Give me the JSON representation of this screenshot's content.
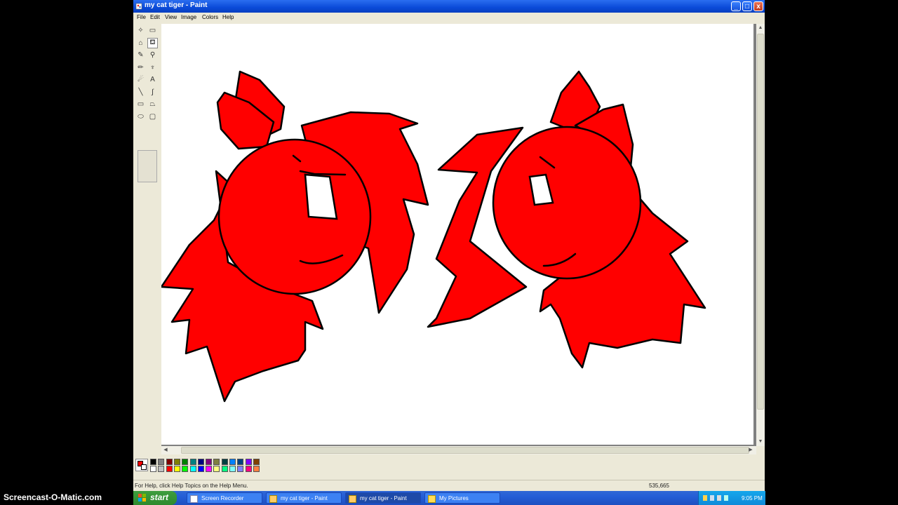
{
  "window": {
    "title": "my cat tiger - Paint",
    "controls": {
      "minimize": "_",
      "maximize": "□",
      "close": "x"
    }
  },
  "menu": {
    "items": [
      "File",
      "Edit",
      "View",
      "Image",
      "Colors",
      "Help"
    ]
  },
  "tools": [
    {
      "name": "free-form-select-icon",
      "glyph": "✧"
    },
    {
      "name": "rect-select-icon",
      "glyph": "▭"
    },
    {
      "name": "eraser-icon",
      "glyph": "⌂"
    },
    {
      "name": "fill-bucket-icon",
      "glyph": "⛾"
    },
    {
      "name": "color-picker-icon",
      "glyph": "✎"
    },
    {
      "name": "magnifier-icon",
      "glyph": "⚲"
    },
    {
      "name": "pencil-icon",
      "glyph": "✏"
    },
    {
      "name": "brush-icon",
      "glyph": "♆"
    },
    {
      "name": "airbrush-icon",
      "glyph": "☄"
    },
    {
      "name": "text-icon",
      "glyph": "A"
    },
    {
      "name": "line-icon",
      "glyph": "╲"
    },
    {
      "name": "curve-icon",
      "glyph": "∫"
    },
    {
      "name": "rectangle-icon",
      "glyph": "▭"
    },
    {
      "name": "polygon-icon",
      "glyph": "⏢"
    },
    {
      "name": "ellipse-icon",
      "glyph": "⬭"
    },
    {
      "name": "rounded-rectangle-icon",
      "glyph": "▢"
    }
  ],
  "selected_tool": "fill-bucket-icon",
  "palette": {
    "foreground": "#ff0000",
    "background": "#ffffff",
    "row1": [
      "#000000",
      "#808080",
      "#800000",
      "#808000",
      "#008000",
      "#008080",
      "#000080",
      "#800080",
      "#808040",
      "#004040",
      "#0080ff",
      "#004080",
      "#8000ff",
      "#804000"
    ],
    "row2": [
      "#ffffff",
      "#c0c0c0",
      "#ff0000",
      "#ffff00",
      "#00ff00",
      "#00ffff",
      "#0000ff",
      "#ff00ff",
      "#ffff80",
      "#00ff80",
      "#80ffff",
      "#8080ff",
      "#ff0080",
      "#ff8040"
    ]
  },
  "status": {
    "help_text": "For Help, click Help Topics on the Help Menu.",
    "coords": "535,665"
  },
  "taskbar": {
    "start_label": "start",
    "tasks": [
      {
        "label": "Screen Recorder",
        "active": false
      },
      {
        "label": "my cat tiger - Paint",
        "active": false
      },
      {
        "label": "my cat tiger - Paint",
        "active": true
      },
      {
        "label": "My Pictures",
        "active": false
      }
    ],
    "clock": "9:05 PM"
  },
  "watermark": "Screencast-O-Matic.com",
  "drawing": {
    "fill_color": "#ff0000",
    "outline_color": "#000000"
  }
}
